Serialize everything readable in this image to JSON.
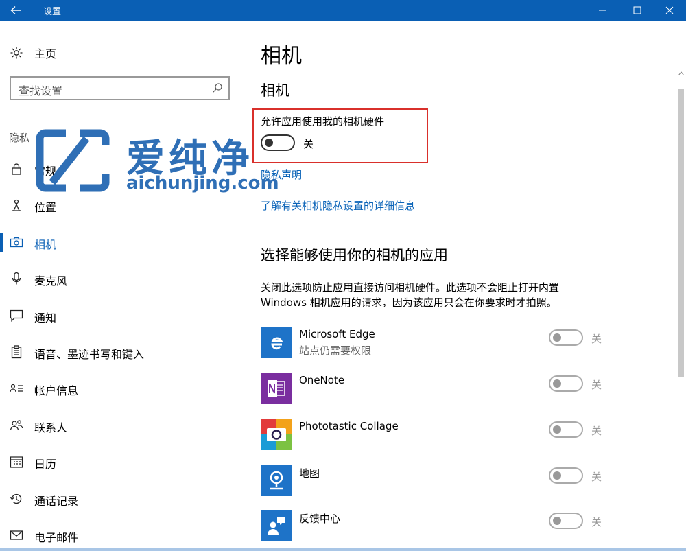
{
  "window": {
    "title": "设置",
    "minimize_icon": "minimize-icon",
    "maximize_icon": "maximize-icon",
    "close_icon": "close-icon"
  },
  "sidebar": {
    "home_label": "主页",
    "search_placeholder": "查找设置",
    "section_label": "隐私",
    "items": [
      {
        "label": "常规",
        "icon": "lock-icon"
      },
      {
        "label": "位置",
        "icon": "location-person-icon"
      },
      {
        "label": "相机",
        "icon": "camera-icon",
        "active": true
      },
      {
        "label": "麦克风",
        "icon": "microphone-icon"
      },
      {
        "label": "通知",
        "icon": "notification-icon"
      },
      {
        "label": "语音、墨迹书写和键入",
        "icon": "clipboard-icon"
      },
      {
        "label": "帐户信息",
        "icon": "account-info-icon"
      },
      {
        "label": "联系人",
        "icon": "contacts-icon"
      },
      {
        "label": "日历",
        "icon": "calendar-icon"
      },
      {
        "label": "通话记录",
        "icon": "history-icon"
      },
      {
        "label": "电子邮件",
        "icon": "mail-icon"
      }
    ]
  },
  "watermark": {
    "chinese": "爱纯净",
    "domain": "aichunjing.com"
  },
  "main": {
    "page_title": "相机",
    "section_title": "相机",
    "allow_label": "允许应用使用我的相机硬件",
    "allow_toggle_state": "关",
    "privacy_link": "隐私声明",
    "learn_more_link": "了解有关相机隐私设置的详细信息",
    "apps_heading": "选择能够使用你的相机的应用",
    "apps_description": "关闭此选项防止应用直接访问相机硬件。此选项不会阻止打开内置 Windows 相机应用的请求，因为该应用只会在你要求时才拍照。",
    "apps": [
      {
        "name": "Microsoft Edge",
        "sub": "站点仍需要权限",
        "state": "关",
        "color": "#1e73c8"
      },
      {
        "name": "OneNote",
        "sub": "",
        "state": "关",
        "color": "#7a2e9f"
      },
      {
        "name": "Phototastic Collage",
        "sub": "",
        "state": "关",
        "color": "#2a1f4f"
      },
      {
        "name": "地图",
        "sub": "",
        "state": "关",
        "color": "#1e73c8"
      },
      {
        "name": "反馈中心",
        "sub": "",
        "state": "关",
        "color": "#1e73c8"
      }
    ]
  },
  "colors": {
    "accent": "#0a5fb4",
    "highlight_border": "#d9302b",
    "link": "#0a63b8"
  }
}
